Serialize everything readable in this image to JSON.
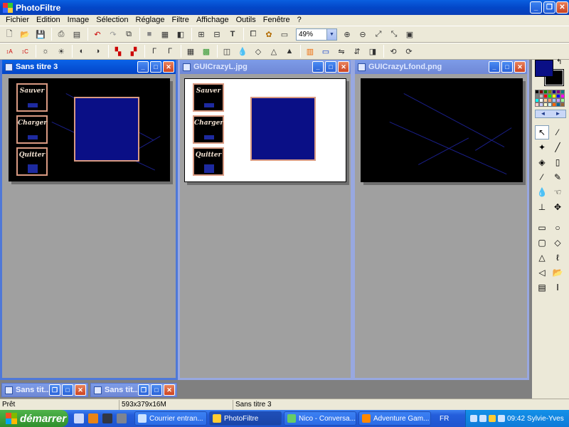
{
  "app": {
    "title": "PhotoFiltre"
  },
  "menu": [
    "Fichier",
    "Edition",
    "Image",
    "Sélection",
    "Réglage",
    "Filtre",
    "Affichage",
    "Outils",
    "Fenêtre",
    "?"
  ],
  "toolbar": {
    "zoom_value": "49%"
  },
  "windows": [
    {
      "title": "Sans titre 3",
      "active": true
    },
    {
      "title": "GUICrazyL.jpg",
      "active": false
    },
    {
      "title": "GUICrazyLfond.png",
      "active": false
    }
  ],
  "gui_buttons": [
    "Sauver",
    "Charger",
    "Quitter"
  ],
  "minimized": [
    {
      "title": "Sans tit..."
    },
    {
      "title": "Sans tit..."
    }
  ],
  "colors": {
    "foreground": "#0a0f86",
    "background": "#000000",
    "accent": "#0347c8"
  },
  "status": {
    "state": "Prêt",
    "dimensions": "593x379x16M",
    "document": "Sans titre 3"
  },
  "taskbar": {
    "start_label": "démarrer",
    "buttons": [
      {
        "label": "Courrier entran...",
        "active": false
      },
      {
        "label": "PhotoFiltre",
        "active": true
      },
      {
        "label": "Nico - Conversa...",
        "active": false
      },
      {
        "label": "Adventure Gam...",
        "active": false
      }
    ],
    "lang": "FR",
    "clock": "09:42",
    "user": "Sylvie-Yves"
  }
}
